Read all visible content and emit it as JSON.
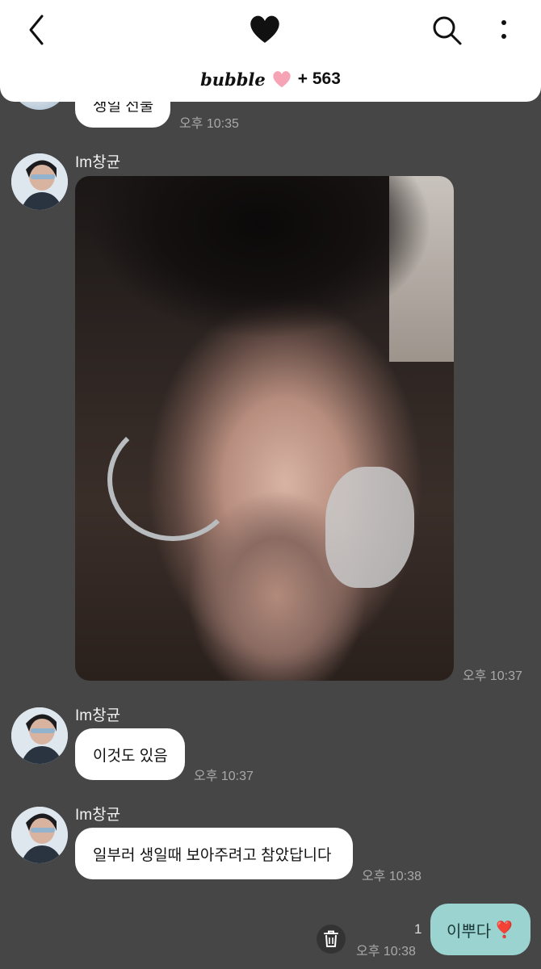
{
  "header": {
    "brand": "bubble",
    "count": "+ 563",
    "icons": {
      "back": "chevron-left-icon",
      "title": "black-heart-icon",
      "search": "search-icon",
      "more": "more-vertical-icon",
      "brand_heart": "pink-heart-icon"
    }
  },
  "messages": [
    {
      "type": "text",
      "text": "생일 선물",
      "time": "오후 10:35"
    },
    {
      "type": "image",
      "sender": "Im창균",
      "time": "오후 10:37"
    },
    {
      "type": "text",
      "sender": "Im창균",
      "text": "이것도 있음",
      "time": "오후 10:37"
    },
    {
      "type": "text",
      "sender": "Im창균",
      "text": "일부러 생일때 보아주려고 참았답니다",
      "time": "오후 10:38"
    }
  ],
  "my_message": {
    "text": "이뿌다",
    "emoji": "❣️",
    "read_count": "1",
    "time": "오후 10:38"
  },
  "colors": {
    "background": "#464646",
    "header": "#ffffff",
    "my_bubble": "#9ad3cf",
    "brand_heart": "#f5a3b5"
  }
}
